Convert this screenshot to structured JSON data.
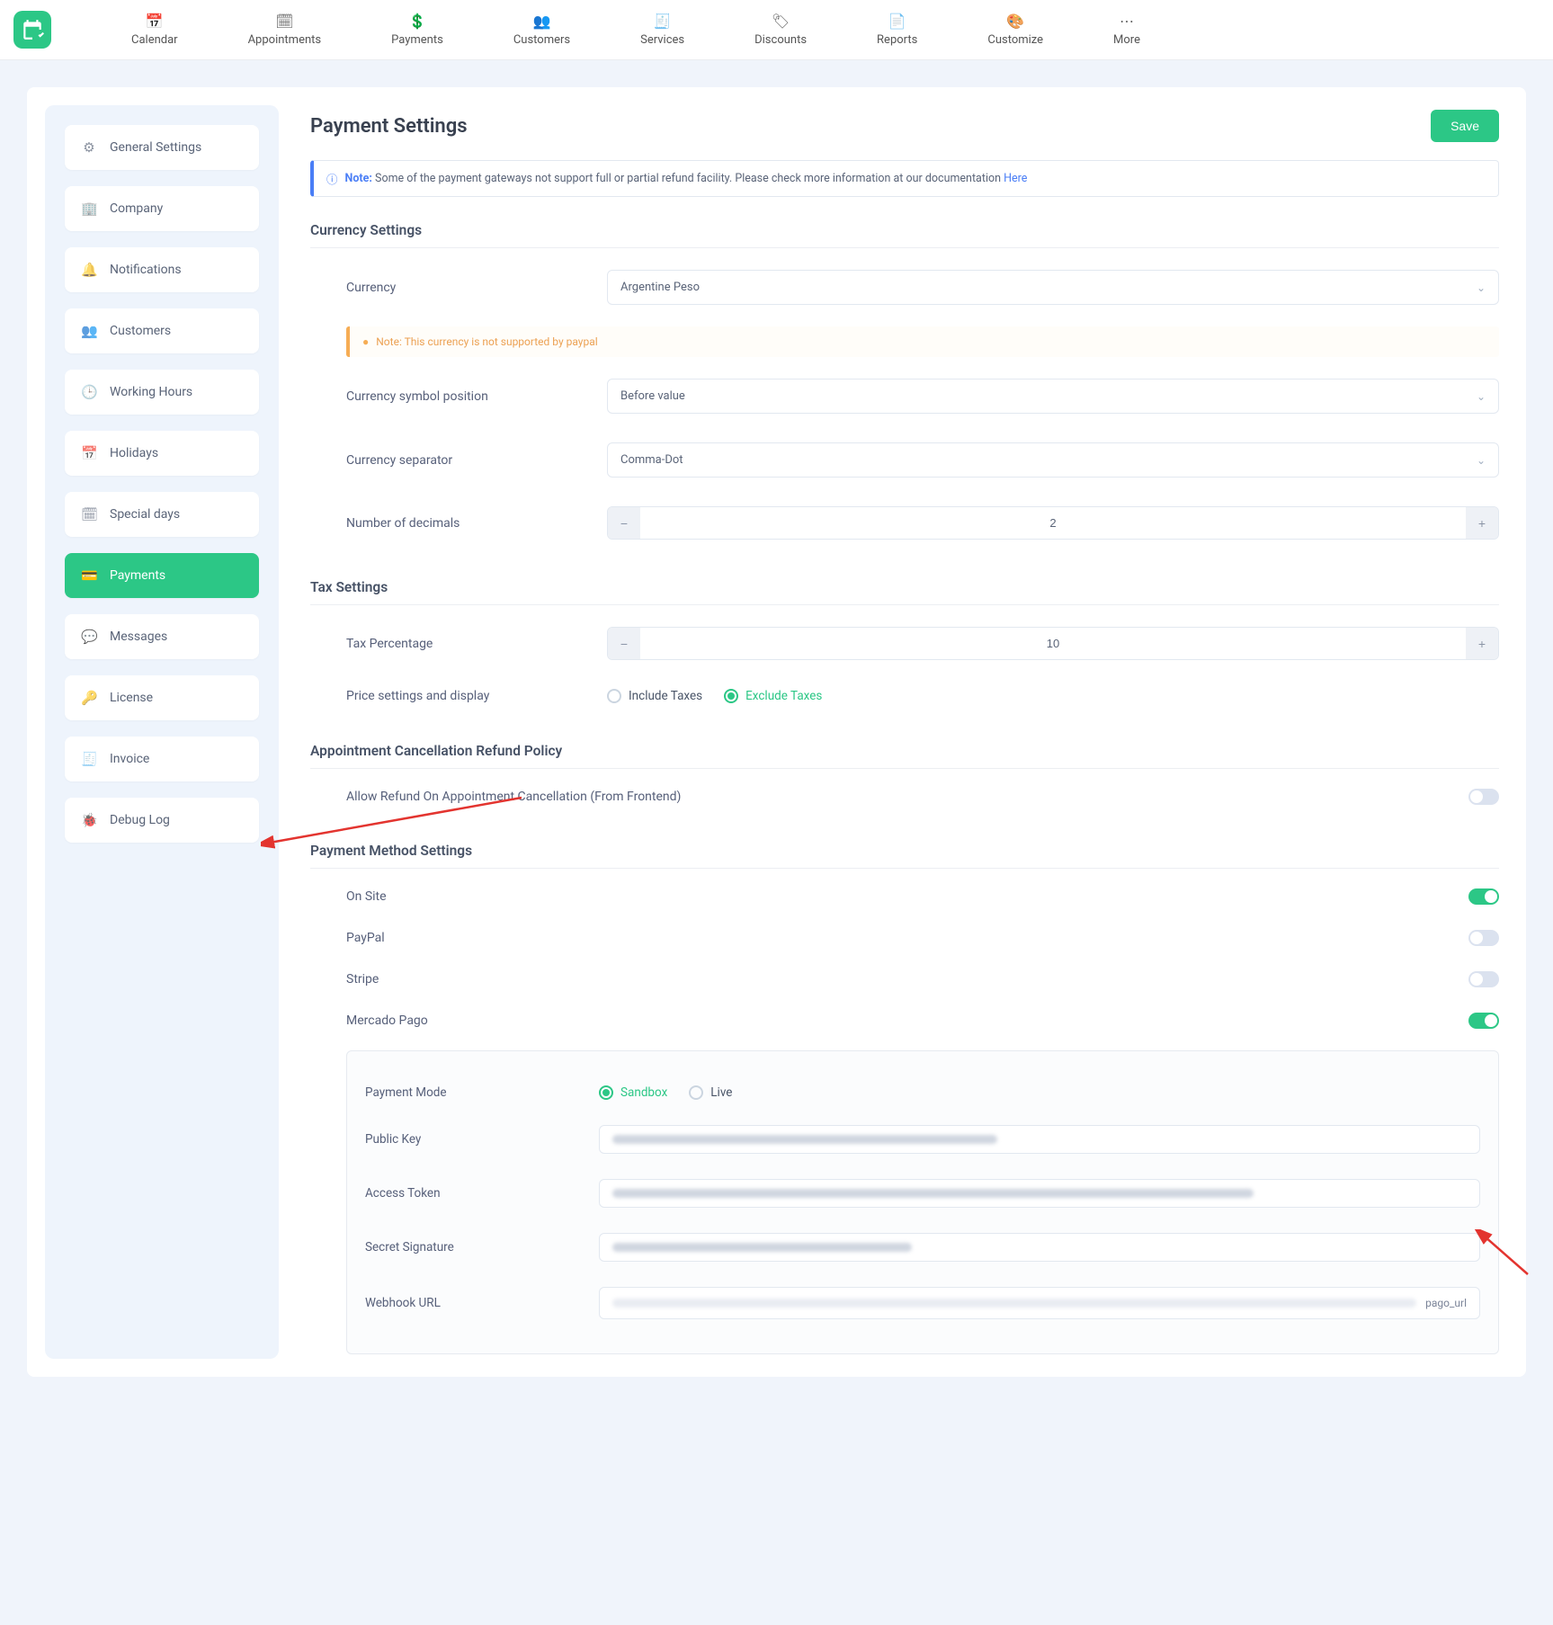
{
  "topnav": [
    {
      "icon": "📅",
      "label": "Calendar"
    },
    {
      "icon": "🗓",
      "label": "Appointments"
    },
    {
      "icon": "💲",
      "label": "Payments"
    },
    {
      "icon": "👥",
      "label": "Customers"
    },
    {
      "icon": "🧾",
      "label": "Services"
    },
    {
      "icon": "🏷",
      "label": "Discounts"
    },
    {
      "icon": "📄",
      "label": "Reports"
    },
    {
      "icon": "🎨",
      "label": "Customize"
    },
    {
      "icon": "⋯",
      "label": "More"
    }
  ],
  "sidebar": [
    {
      "icon": "⚙",
      "label": "General Settings"
    },
    {
      "icon": "🏢",
      "label": "Company"
    },
    {
      "icon": "🔔",
      "label": "Notifications"
    },
    {
      "icon": "👥",
      "label": "Customers"
    },
    {
      "icon": "🕒",
      "label": "Working Hours"
    },
    {
      "icon": "📅",
      "label": "Holidays"
    },
    {
      "icon": "🗓",
      "label": "Special days"
    },
    {
      "icon": "💳",
      "label": "Payments"
    },
    {
      "icon": "💬",
      "label": "Messages"
    },
    {
      "icon": "🔑",
      "label": "License"
    },
    {
      "icon": "🧾",
      "label": "Invoice"
    },
    {
      "icon": "🐞",
      "label": "Debug Log"
    }
  ],
  "active_sidebar": "Payments",
  "page_title": "Payment Settings",
  "save_label": "Save",
  "note": {
    "prefix": "Note:",
    "text": "Some of the payment gateways not support full or partial refund facility. Please check more information at our documentation",
    "link": "Here"
  },
  "sections": {
    "currency": {
      "title": "Currency Settings",
      "currency_label": "Currency",
      "currency_value": "Argentine Peso",
      "warn": "Note: This currency is not supported by paypal",
      "pos_label": "Currency symbol position",
      "pos_value": "Before value",
      "sep_label": "Currency separator",
      "sep_value": "Comma-Dot",
      "dec_label": "Number of decimals",
      "dec_value": "2"
    },
    "tax": {
      "title": "Tax Settings",
      "pct_label": "Tax Percentage",
      "pct_value": "10",
      "disp_label": "Price settings and display",
      "include": "Include Taxes",
      "exclude": "Exclude Taxes"
    },
    "refund": {
      "title": "Appointment Cancellation Refund Policy",
      "allow_label": "Allow Refund On Appointment Cancellation (From Frontend)"
    },
    "method": {
      "title": "Payment Method Settings",
      "onsite": "On Site",
      "paypal": "PayPal",
      "stripe": "Stripe",
      "mp": "Mercado Pago"
    },
    "mp": {
      "mode_label": "Payment Mode",
      "sandbox": "Sandbox",
      "live": "Live",
      "pk_label": "Public Key",
      "at_label": "Access Token",
      "ss_label": "Secret Signature",
      "wh_label": "Webhook URL",
      "wh_suffix": "pago_url"
    }
  }
}
